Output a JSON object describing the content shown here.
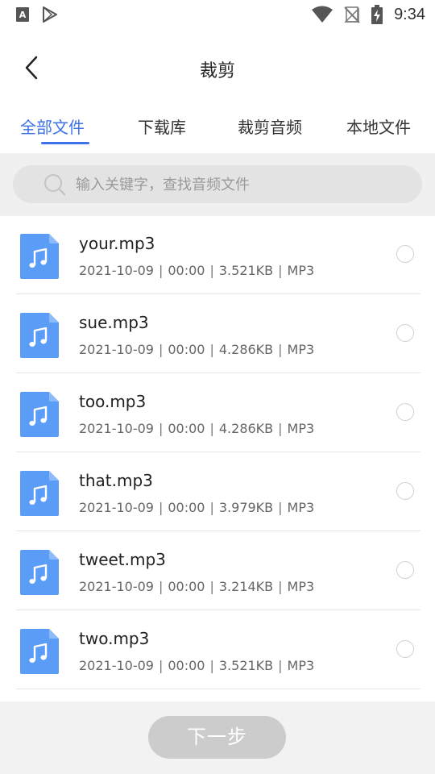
{
  "status_bar": {
    "time": "9:34",
    "left_icons": [
      "font-a-icon",
      "play-store-icon"
    ],
    "right_icons": [
      "wifi-icon",
      "no-signal-icon",
      "battery-charging-icon"
    ]
  },
  "header": {
    "title": "裁剪",
    "back_icon": "chevron-left-icon"
  },
  "tabs": [
    {
      "label": "全部文件",
      "active": true
    },
    {
      "label": "下载库",
      "active": false
    },
    {
      "label": "裁剪音频",
      "active": false
    },
    {
      "label": "本地文件",
      "active": false
    }
  ],
  "search": {
    "placeholder": "输入关键字，查找音频文件",
    "value": ""
  },
  "files": [
    {
      "name": "your.mp3",
      "date": "2021-10-09",
      "duration": "00:00",
      "size": "3.521KB",
      "format": "MP3",
      "selected": false
    },
    {
      "name": "sue.mp3",
      "date": "2021-10-09",
      "duration": "00:00",
      "size": "4.286KB",
      "format": "MP3",
      "selected": false
    },
    {
      "name": "too.mp3",
      "date": "2021-10-09",
      "duration": "00:00",
      "size": "4.286KB",
      "format": "MP3",
      "selected": false
    },
    {
      "name": "that.mp3",
      "date": "2021-10-09",
      "duration": "00:00",
      "size": "3.979KB",
      "format": "MP3",
      "selected": false
    },
    {
      "name": "tweet.mp3",
      "date": "2021-10-09",
      "duration": "00:00",
      "size": "3.214KB",
      "format": "MP3",
      "selected": false
    },
    {
      "name": "two.mp3",
      "date": "2021-10-09",
      "duration": "00:00",
      "size": "3.521KB",
      "format": "MP3",
      "selected": false
    }
  ],
  "bottom": {
    "next_label": "下一步"
  },
  "colors": {
    "accent": "#3d72e8",
    "file_icon": "#5b9cf6",
    "button_disabled": "#cccccc"
  }
}
